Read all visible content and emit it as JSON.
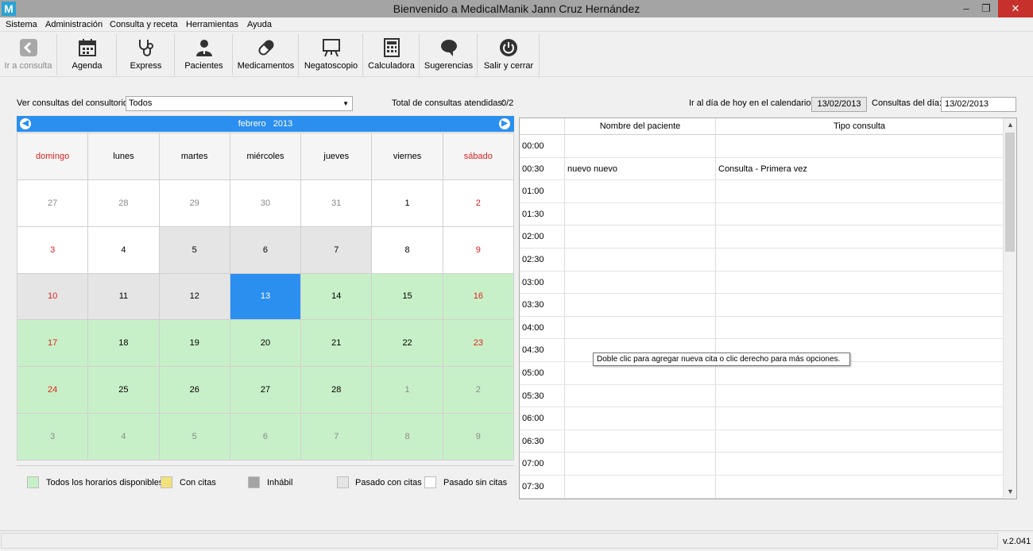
{
  "app": {
    "icon_letter": "M",
    "title": "Bienvenido a MedicalManik  Jann Cruz Hernández",
    "window_controls": {
      "minimize": "–",
      "maximize": "❐",
      "close": "✕"
    }
  },
  "menu": [
    "Sistema",
    "Administración",
    "Consulta y receta",
    "Herramientas",
    "Ayuda"
  ],
  "toolbar": [
    {
      "label": "Ir a consulta",
      "icon": "back-arrow-icon",
      "disabled": true
    },
    {
      "label": "Agenda",
      "icon": "calendar-icon"
    },
    {
      "label": "Express",
      "icon": "stethoscope-icon"
    },
    {
      "label": "Pacientes",
      "icon": "patient-icon"
    },
    {
      "label": "Medicamentos",
      "icon": "pill-icon"
    },
    {
      "label": "Negatoscopio",
      "icon": "xray-viewer-icon"
    },
    {
      "label": "Calculadora",
      "icon": "calculator-icon"
    },
    {
      "label": "Sugerencias",
      "icon": "speech-bubble-icon"
    },
    {
      "label": "Salir y cerrar",
      "icon": "power-icon"
    }
  ],
  "filters": {
    "office_label": "Ver consultas del consultorio:",
    "office_value": "Todos",
    "total_label": "Total de consultas atendidas:",
    "total_value": "0/2",
    "goto_label": "Ir al día de hoy en el calendario:",
    "goto_value": "13/02/2013",
    "day_label": "Consultas del día:",
    "day_value": "13/02/2013"
  },
  "calendar": {
    "month": "febrero",
    "year": "2013",
    "weekdays": [
      {
        "label": "domingo",
        "red": true
      },
      {
        "label": "lunes",
        "red": false
      },
      {
        "label": "martes",
        "red": false
      },
      {
        "label": "miércoles",
        "red": false
      },
      {
        "label": "jueves",
        "red": false
      },
      {
        "label": "viernes",
        "red": false
      },
      {
        "label": "sábado",
        "red": true
      }
    ],
    "weeks": [
      [
        {
          "d": "27",
          "state": "other"
        },
        {
          "d": "28",
          "state": "other"
        },
        {
          "d": "29",
          "state": "other"
        },
        {
          "d": "30",
          "state": "other"
        },
        {
          "d": "31",
          "state": "other"
        },
        {
          "d": "1",
          "state": "past"
        },
        {
          "d": "2",
          "state": "past",
          "red": true
        }
      ],
      [
        {
          "d": "3",
          "state": "past",
          "red": true
        },
        {
          "d": "4",
          "state": "past"
        },
        {
          "d": "5",
          "state": "inactive"
        },
        {
          "d": "6",
          "state": "inactive"
        },
        {
          "d": "7",
          "state": "inactive"
        },
        {
          "d": "8",
          "state": "past"
        },
        {
          "d": "9",
          "state": "past",
          "red": true
        }
      ],
      [
        {
          "d": "10",
          "state": "inactive",
          "red": true
        },
        {
          "d": "11",
          "state": "inactive"
        },
        {
          "d": "12",
          "state": "inactive"
        },
        {
          "d": "13",
          "state": "selected"
        },
        {
          "d": "14",
          "state": "avail"
        },
        {
          "d": "15",
          "state": "avail"
        },
        {
          "d": "16",
          "state": "avail",
          "red": true
        }
      ],
      [
        {
          "d": "17",
          "state": "avail",
          "red": true
        },
        {
          "d": "18",
          "state": "avail"
        },
        {
          "d": "19",
          "state": "avail"
        },
        {
          "d": "20",
          "state": "avail"
        },
        {
          "d": "21",
          "state": "avail"
        },
        {
          "d": "22",
          "state": "avail"
        },
        {
          "d": "23",
          "state": "avail",
          "red": true
        }
      ],
      [
        {
          "d": "24",
          "state": "avail",
          "red": true
        },
        {
          "d": "25",
          "state": "avail"
        },
        {
          "d": "26",
          "state": "avail"
        },
        {
          "d": "27",
          "state": "avail"
        },
        {
          "d": "28",
          "state": "avail"
        },
        {
          "d": "1",
          "state": "avail-other"
        },
        {
          "d": "2",
          "state": "avail-other"
        }
      ],
      [
        {
          "d": "3",
          "state": "avail-other"
        },
        {
          "d": "4",
          "state": "avail-other"
        },
        {
          "d": "5",
          "state": "avail-other"
        },
        {
          "d": "6",
          "state": "avail-other"
        },
        {
          "d": "7",
          "state": "avail-other"
        },
        {
          "d": "8",
          "state": "avail-other"
        },
        {
          "d": "9",
          "state": "avail-other"
        }
      ]
    ]
  },
  "legend": [
    {
      "label": "Todos los horarios disponibles",
      "color": "#c8f0c8"
    },
    {
      "label": "Con citas",
      "color": "#f3e27a"
    },
    {
      "label": "Inhábil",
      "color": "#a4a4a4"
    },
    {
      "label": "Pasado con citas",
      "color": "#e5e5e5"
    },
    {
      "label": "Pasado sin citas",
      "color": "#ffffff"
    }
  ],
  "schedule": {
    "headers": [
      "Nombre del paciente",
      "Tipo consulta"
    ],
    "rows": [
      {
        "time": "00:00",
        "name": "",
        "type": ""
      },
      {
        "time": "00:30",
        "name": "nuevo nuevo",
        "type": "Consulta - Primera vez"
      },
      {
        "time": "01:00",
        "name": "",
        "type": ""
      },
      {
        "time": "01:30",
        "name": "",
        "type": ""
      },
      {
        "time": "02:00",
        "name": "",
        "type": ""
      },
      {
        "time": "02:30",
        "name": "",
        "type": ""
      },
      {
        "time": "03:00",
        "name": "",
        "type": ""
      },
      {
        "time": "03:30",
        "name": "",
        "type": ""
      },
      {
        "time": "04:00",
        "name": "",
        "type": ""
      },
      {
        "time": "04:30",
        "name": "",
        "type": ""
      },
      {
        "time": "05:00",
        "name": "",
        "type": ""
      },
      {
        "time": "05:30",
        "name": "",
        "type": ""
      },
      {
        "time": "06:00",
        "name": "",
        "type": ""
      },
      {
        "time": "06:30",
        "name": "",
        "type": ""
      },
      {
        "time": "07:00",
        "name": "",
        "type": ""
      },
      {
        "time": "07:30",
        "name": "",
        "type": ""
      }
    ],
    "tooltip": "Doble clic para agregar nueva cita o clic derecho para más opciones."
  },
  "status": {
    "version": "v.2.041"
  },
  "colors": {
    "accent": "#2b8ff0",
    "available": "#c8f0c8",
    "weekend_text": "#e01f1f",
    "close_button": "#c7312b"
  }
}
